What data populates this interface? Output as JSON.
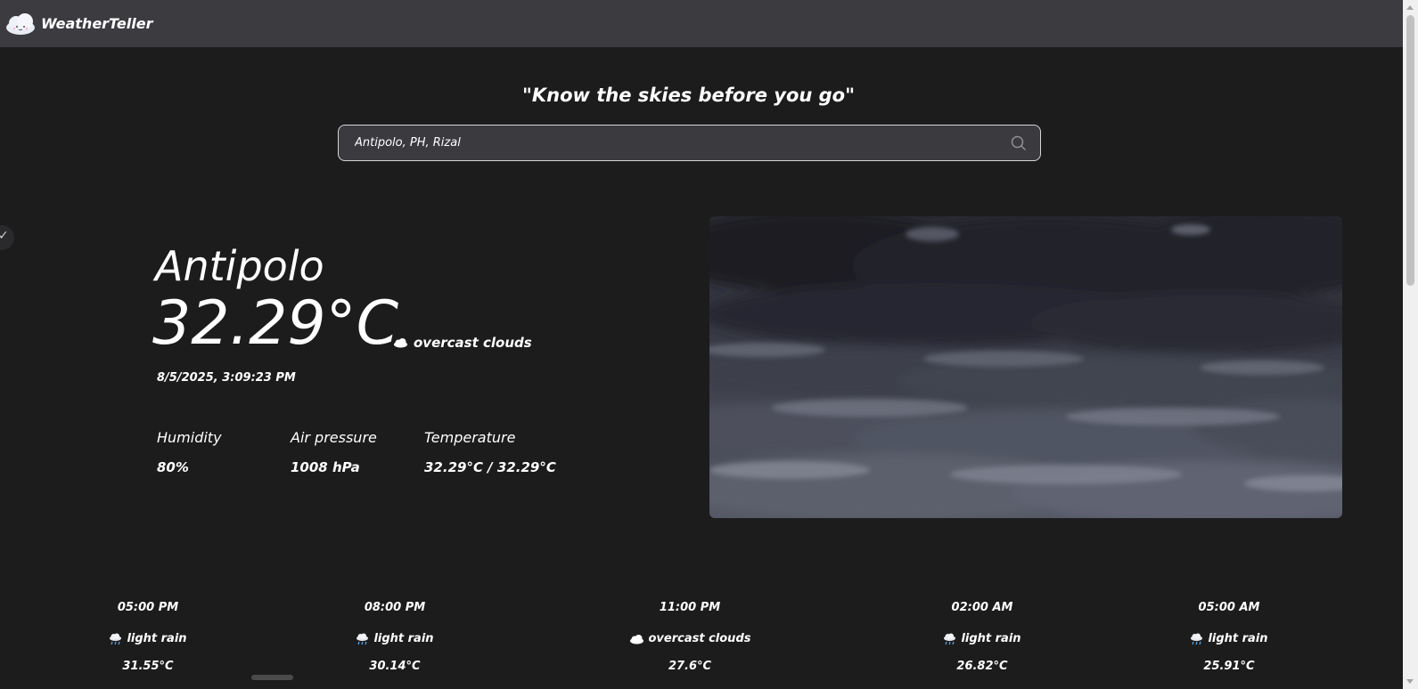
{
  "app": {
    "brand": "WeatherTeller",
    "tagline": "\"Know the skies before you go\""
  },
  "search": {
    "value": "Antipolo, PH, Rizal",
    "placeholder": ""
  },
  "current": {
    "city": "Antipolo",
    "temperature": "32.29°C",
    "condition": "overcast clouds",
    "condition_icon": "cloud-icon",
    "datetime": "8/5/2025, 3:09:23 PM",
    "stats": [
      {
        "label": "Humidity",
        "value": "80%"
      },
      {
        "label": "Air pressure",
        "value": "1008 hPa"
      },
      {
        "label": "Temperature",
        "value": "32.29°C / 32.29°C"
      }
    ]
  },
  "forecast": [
    {
      "time": "05:00 PM",
      "condition": "light rain",
      "icon": "rain-icon",
      "temp": "31.55°C"
    },
    {
      "time": "08:00 PM",
      "condition": "light rain",
      "icon": "rain-icon",
      "temp": "30.14°C"
    },
    {
      "time": "11:00 PM",
      "condition": "overcast clouds",
      "icon": "cloud-icon",
      "temp": "27.6°C"
    },
    {
      "time": "02:00 AM",
      "condition": "light rain",
      "icon": "rain-icon",
      "temp": "26.82°C"
    },
    {
      "time": "05:00 AM",
      "condition": "light rain",
      "icon": "rain-icon",
      "temp": "25.91°C"
    }
  ],
  "colors": {
    "background": "#1c1c1d",
    "navbar": "#3c3b40",
    "search_bg": "#3b3a3f",
    "text": "#ffffff"
  }
}
